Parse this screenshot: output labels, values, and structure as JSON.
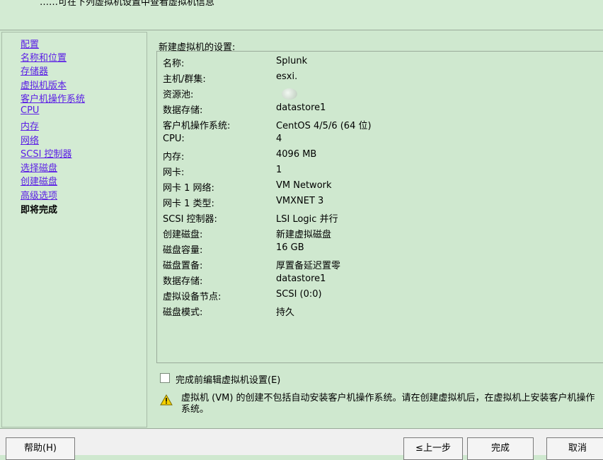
{
  "header": {
    "description": "……可在下列虚拟机设置中查看虚拟机信息"
  },
  "nav": {
    "items": [
      {
        "label": "配置"
      },
      {
        "label": "名称和位置"
      },
      {
        "label": "存储器"
      },
      {
        "label": "虚拟机版本"
      },
      {
        "label": "客户机操作系统"
      },
      {
        "label": "CPU"
      },
      {
        "label": "内存"
      },
      {
        "label": "网络"
      },
      {
        "label": "SCSI 控制器"
      },
      {
        "label": "选择磁盘"
      },
      {
        "label": "创建磁盘"
      },
      {
        "label": "高级选项"
      },
      {
        "label": "即将完成"
      }
    ]
  },
  "main": {
    "title": "新建虚拟机的设置:",
    "rows": [
      {
        "label": "名称:",
        "value": "Splunk"
      },
      {
        "label": "主机/群集:",
        "value": "esxi."
      },
      {
        "label": "资源池:",
        "value": ""
      },
      {
        "label": "数据存储:",
        "value": "datastore1"
      },
      {
        "label": "客户机操作系统:",
        "value": "CentOS 4/5/6 (64 位)"
      },
      {
        "label": "CPU:",
        "value": "4"
      },
      {
        "label": "内存:",
        "value": "4096 MB"
      },
      {
        "label": "网卡:",
        "value": "1"
      },
      {
        "label": "网卡 1 网络:",
        "value": "VM Network"
      },
      {
        "label": "网卡 1 类型:",
        "value": "VMXNET 3"
      },
      {
        "label": "SCSI 控制器:",
        "value": "LSI Logic 并行"
      },
      {
        "label": "创建磁盘:",
        "value": "新建虚拟磁盘"
      },
      {
        "label": "磁盘容量:",
        "value": "16 GB"
      },
      {
        "label": "磁盘置备:",
        "value": "厚置备延迟置零"
      },
      {
        "label": "数据存储:",
        "value": "datastore1"
      },
      {
        "label": "虚拟设备节点:",
        "value": "SCSI (0:0)"
      },
      {
        "label": "磁盘模式:",
        "value": "持久"
      }
    ],
    "edit_checkbox_label": "完成前编辑虚拟机设置(E)",
    "edit_checkbox_checked": false,
    "warning_text": "虚拟机 (VM) 的创建不包括自动安装客户机操作系统。请在创建虚拟机后，在虚拟机上安装客户机操作系统。"
  },
  "footer": {
    "help_label": "帮助(H)",
    "back_label": "≤上一步",
    "finish_label": "完成",
    "cancel_label": "取消"
  },
  "colors": {
    "background": "#cfe8cf",
    "link": "#5b1ee6",
    "warning": "#f5d000"
  }
}
